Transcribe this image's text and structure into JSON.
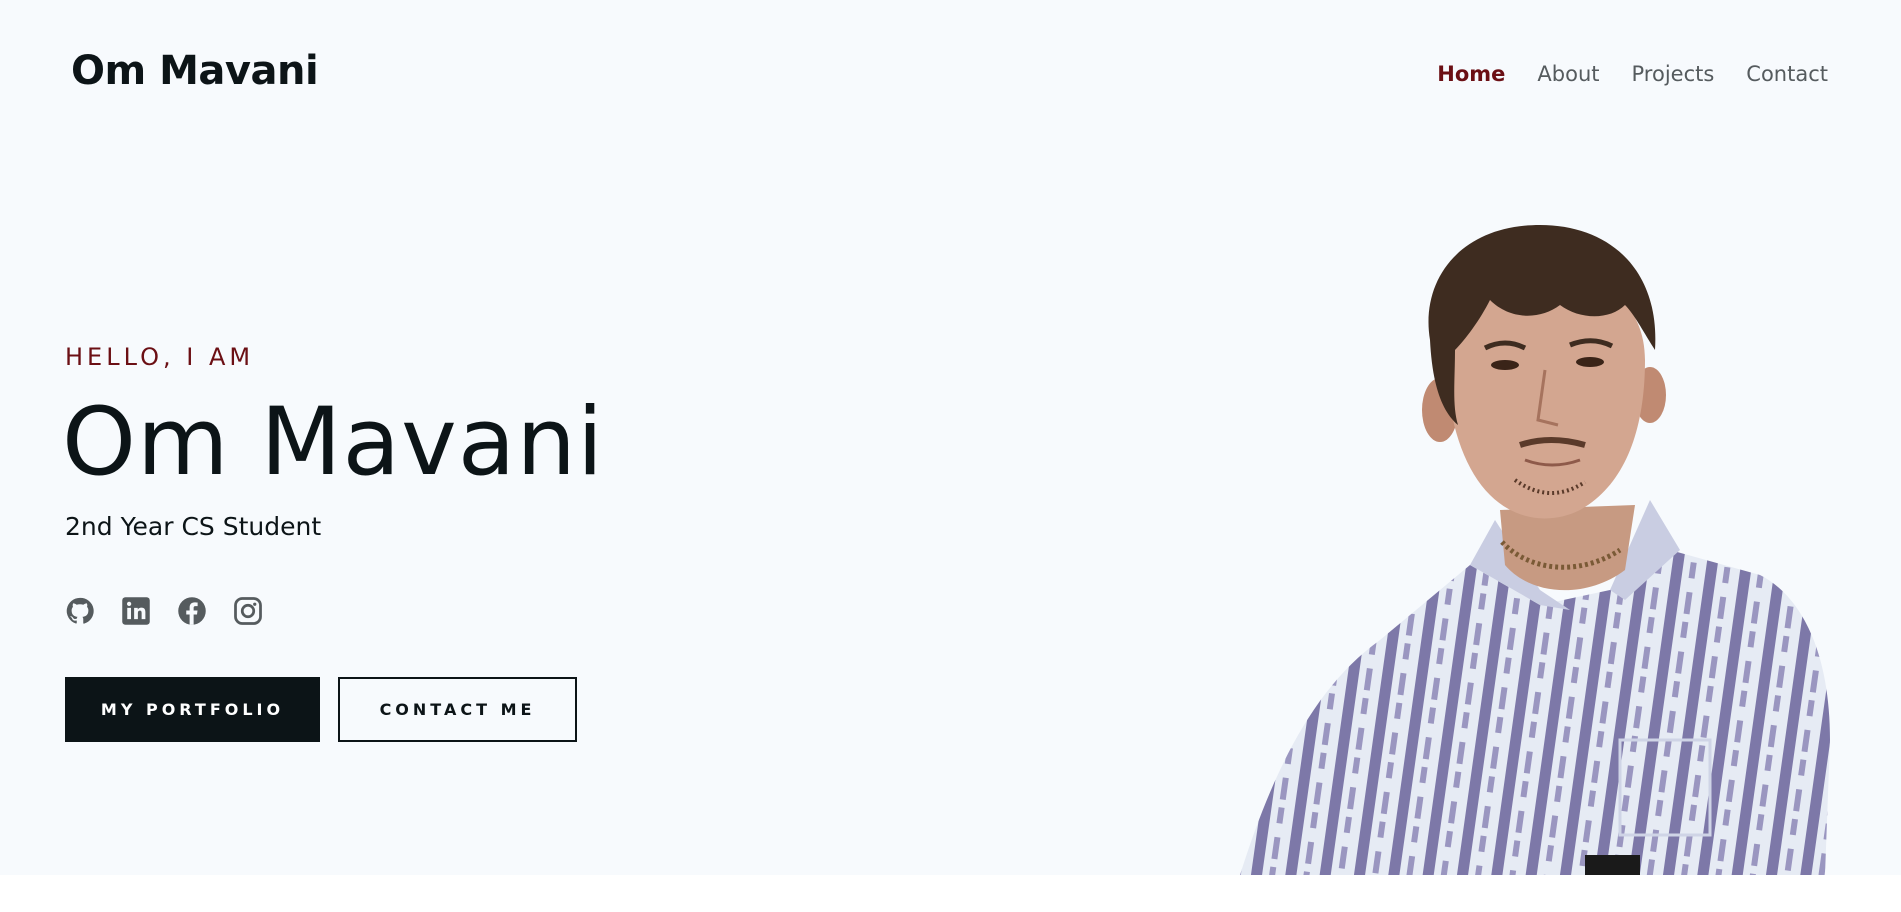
{
  "header": {
    "logo": "Om Mavani",
    "nav": [
      {
        "label": "Home",
        "active": true
      },
      {
        "label": "About",
        "active": false
      },
      {
        "label": "Projects",
        "active": false
      },
      {
        "label": "Contact",
        "active": false
      }
    ]
  },
  "hero": {
    "greeting": "HELLO, I AM",
    "name": "Om Mavani",
    "role": "2nd Year CS Student",
    "socials": [
      {
        "icon": "github-icon"
      },
      {
        "icon": "linkedin-icon"
      },
      {
        "icon": "facebook-icon"
      },
      {
        "icon": "instagram-icon"
      }
    ],
    "buttons": {
      "primary": "MY PORTFOLIO",
      "secondary": "CONTACT ME"
    }
  },
  "colors": {
    "accent": "#6b0f14",
    "dark": "#0c1417",
    "background": "#f7fafd",
    "nav_text": "#555b5e",
    "icon": "#555b5e"
  }
}
